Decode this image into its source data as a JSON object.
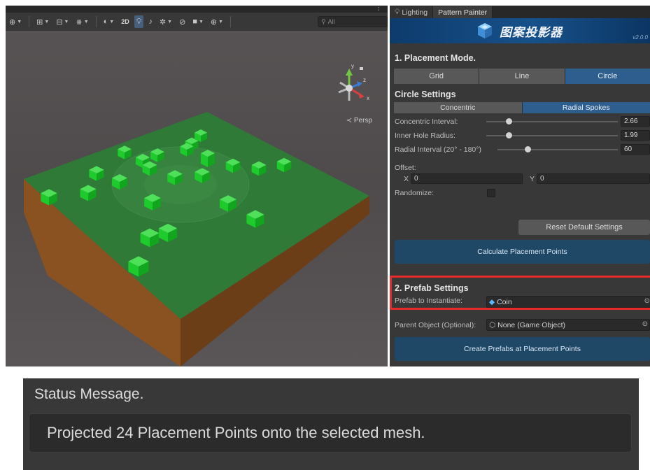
{
  "colors": {
    "panel_bg": "#383838",
    "accent_blue": "#2d5e8e",
    "primary_button": "#1f4867",
    "highlight_red": "#e42a2a",
    "ground_green": "#2f7a37",
    "coin_green": "#1ecb2c",
    "soil_brown": "#8a5220"
  },
  "scene": {
    "toolbar": {
      "mode_2d": "2D",
      "search_placeholder": "All",
      "icons": [
        "globe-icon",
        "grid-snap-icon",
        "grid-increment-icon",
        "ruler-icon",
        "shading-mode-icon",
        "lightbulb-icon",
        "audio-icon",
        "effects-icon",
        "visibility-icon",
        "camera-icon",
        "gizmos-icon",
        "search-icon"
      ]
    },
    "gizmo_axes": {
      "y": "y",
      "z": "z",
      "x": "x"
    },
    "persp_label": "≺ Persp"
  },
  "panel": {
    "tabs": [
      {
        "label": "Lighting",
        "icon": "lightbulb-icon",
        "active": false
      },
      {
        "label": "Pattern Painter",
        "active": true
      }
    ],
    "banner": {
      "title": "图案投影器",
      "version": "v2.0.0",
      "icon": "cube-logo-icon"
    },
    "placement": {
      "title": "1. Placement Mode.",
      "modes": [
        {
          "label": "Grid",
          "selected": false
        },
        {
          "label": "Line",
          "selected": false
        },
        {
          "label": "Circle",
          "selected": true
        }
      ]
    },
    "circle": {
      "title": "Circle Settings",
      "types": [
        {
          "label": "Concentric",
          "selected": false
        },
        {
          "label": "Radial Spokes",
          "selected": true
        }
      ],
      "sliders": [
        {
          "label": "Concentric Interval:",
          "value": "2.66",
          "fraction": 0.17
        },
        {
          "label": "Inner Hole Radius:",
          "value": "1.99",
          "fraction": 0.17
        },
        {
          "label": "Radial Interval (20° - 180°)",
          "value": "60",
          "fraction": 0.25
        }
      ],
      "offset_label": "Offset:",
      "offset_x_label": "X",
      "offset_x": "0",
      "offset_y_label": "Y",
      "offset_y": "0",
      "randomize_label": "Randomize:",
      "randomize_checked": false,
      "reset_button": "Reset Default Settings",
      "calculate_button": "Calculate Placement Points"
    },
    "prefab": {
      "title": "2. Prefab Settings",
      "prefab_label": "Prefab to Instantiate:",
      "prefab_value": "Coin",
      "parent_label": "Parent Object (Optional):",
      "parent_value": "None (Game Object)",
      "create_button": "Create Prefabs at Placement Points"
    }
  },
  "status": {
    "title": "Status Message.",
    "message": "Projected 24 Placement Points onto the selected mesh."
  }
}
